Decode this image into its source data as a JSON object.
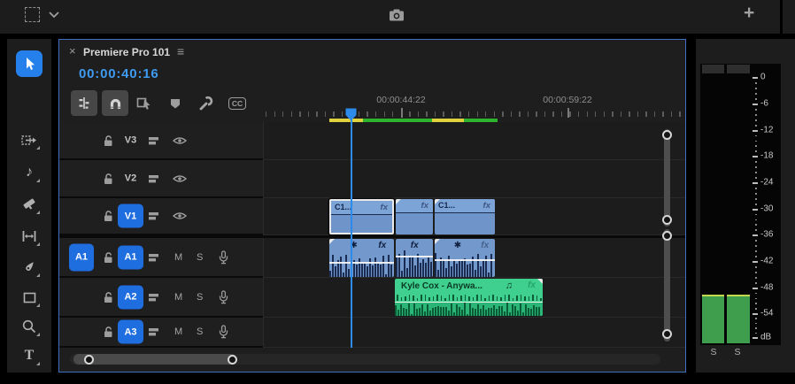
{
  "topbar": {
    "plus_label": "+"
  },
  "timeline_panel": {
    "tab": {
      "close": "×",
      "title": "Premiere Pro 101",
      "menu": "≡"
    },
    "timecode": "00:00:40:16",
    "toolbar": {
      "cc_label": "CC"
    },
    "ruler_labels": [
      "00:00:44:22",
      "00:00:59:22"
    ]
  },
  "tools": {
    "type_glyph": "T",
    "remix_glyph": "♪"
  },
  "tracks": {
    "video": [
      {
        "label": "V3",
        "targeted": false
      },
      {
        "label": "V2",
        "targeted": false
      },
      {
        "label": "V1",
        "targeted": true
      }
    ],
    "audio": [
      {
        "source": "A1",
        "label": "A1",
        "mute": "M",
        "solo": "S"
      },
      {
        "source": "",
        "label": "A2",
        "mute": "M",
        "solo": "S"
      },
      {
        "source": "",
        "label": "A3",
        "mute": "M",
        "solo": "S"
      }
    ]
  },
  "clips": {
    "v1": [
      {
        "label": "C1...",
        "fx": "fx",
        "selected": true
      },
      {
        "label": "",
        "fx": "fx",
        "selected": false
      },
      {
        "label": "C1...",
        "fx": "fx",
        "selected": false
      }
    ],
    "a1": [
      {
        "star": "✱",
        "fx": "fx"
      },
      {
        "star": "",
        "fx": "fx"
      },
      {
        "star": "✱",
        "fx": "fx"
      }
    ],
    "a2": [
      {
        "label": "Kyle Cox - Anywa...",
        "note": "♫",
        "fx": "fx"
      }
    ]
  },
  "meters": {
    "scale": [
      "0",
      "-6",
      "-12",
      "-18",
      "-24",
      "-30",
      "-36",
      "-42",
      "-48",
      "-54",
      "dB"
    ],
    "solo_labels": [
      "S",
      "S"
    ]
  },
  "colors": {
    "accent_blue": "#2680eb",
    "timecode_blue": "#3e9bf2",
    "clip_blue": "#7298cc",
    "waveform_navy": "#1a2c52",
    "clip_green": "#3fcf8e",
    "render_green": "#2db32d",
    "render_yellow": "#e0d23e",
    "meter_green": "#3f9e4d"
  }
}
